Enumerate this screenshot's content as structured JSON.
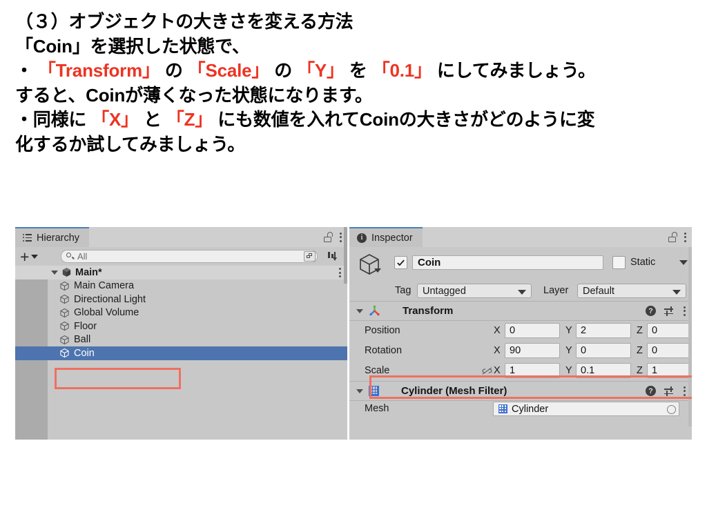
{
  "slide": {
    "lines": [
      [
        {
          "t": "（３）オブジェクトの大きさを変える方法",
          "c": "black"
        }
      ],
      [
        {
          "t": "「Coin」を選択した状態で、",
          "c": "black"
        }
      ],
      [
        {
          "t": "・",
          "c": "black"
        },
        {
          "t": "「Transform」",
          "c": "red"
        },
        {
          "t": "の",
          "c": "black"
        },
        {
          "t": "「Scale」",
          "c": "red"
        },
        {
          "t": "の",
          "c": "black"
        },
        {
          "t": "「Y」",
          "c": "red"
        },
        {
          "t": "を",
          "c": "black"
        },
        {
          "t": "「0.1」",
          "c": "red"
        },
        {
          "t": "にしてみましょう。",
          "c": "black"
        }
      ],
      [
        {
          "t": "すると、Coinが薄くなった状態になります。",
          "c": "black"
        }
      ],
      [
        {
          "t": "・同様に",
          "c": "black"
        },
        {
          "t": "「X」",
          "c": "red"
        },
        {
          "t": "と",
          "c": "black"
        },
        {
          "t": "「Z」",
          "c": "red"
        },
        {
          "t": "にも数値を入れてCoinの大きさがどのように変",
          "c": "black"
        }
      ],
      [
        {
          "t": "化するか試してみましょう。",
          "c": "black"
        }
      ]
    ],
    "accent_red": "#ee3322"
  },
  "hierarchy": {
    "tab_label": "Hierarchy",
    "tab_icon": "list-icon",
    "lock_icon": "lock-open-icon",
    "menu_icon": "kebab-menu-icon",
    "add_button_label": "+",
    "search": {
      "value": "All",
      "placeholder": "All",
      "icon": "search-icon",
      "popout_icon": "popout-icon"
    },
    "sort_icon": "sort-icon",
    "root": {
      "label": "Main*",
      "expanded": true,
      "icon": "unity-scene-icon"
    },
    "items": [
      {
        "label": "Main Camera",
        "icon": "gameobject-cube-icon",
        "selected": false
      },
      {
        "label": "Directional Light",
        "icon": "gameobject-cube-icon",
        "selected": false
      },
      {
        "label": "Global Volume",
        "icon": "gameobject-cube-icon",
        "selected": false
      },
      {
        "label": "Floor",
        "icon": "gameobject-cube-icon",
        "selected": false
      },
      {
        "label": "Ball",
        "icon": "gameobject-cube-icon",
        "selected": false
      },
      {
        "label": "Coin",
        "icon": "gameobject-cube-icon",
        "selected": true
      }
    ],
    "selection_color": "#4d74ae",
    "highlight_color": "#ef7060"
  },
  "inspector": {
    "tab_label": "Inspector",
    "tab_icon": "info-icon",
    "lock_icon": "lock-open-icon",
    "menu_icon": "kebab-menu-icon",
    "object": {
      "icon": "gameobject-cube-icon",
      "enabled": true,
      "name": "Coin",
      "static_label": "Static",
      "static_checked": false
    },
    "tag": {
      "label": "Tag",
      "value": "Untagged"
    },
    "layer": {
      "label": "Layer",
      "value": "Default"
    },
    "transform": {
      "title": "Transform",
      "icon": "transform-gizmo-icon",
      "expanded": true,
      "help_icon": "help-icon",
      "preset_icon": "settings-sliders-icon",
      "menu_icon": "kebab-menu-icon",
      "rows": [
        {
          "label": "Position",
          "x": "0",
          "y": "2",
          "z": "0",
          "highlighted": false,
          "link_icon": null
        },
        {
          "label": "Rotation",
          "x": "90",
          "y": "0",
          "z": "0",
          "highlighted": false,
          "link_icon": null
        },
        {
          "label": "Scale",
          "x": "1",
          "y": "0.1",
          "z": "1",
          "highlighted": true,
          "link_icon": "link-broken-icon"
        }
      ],
      "axis_labels": [
        "X",
        "Y",
        "Z"
      ]
    },
    "mesh_filter": {
      "title": "Cylinder (Mesh Filter)",
      "icon": "mesh-grid-icon",
      "expanded": true,
      "help_icon": "help-icon",
      "preset_icon": "settings-sliders-icon",
      "menu_icon": "kebab-menu-icon",
      "mesh_label": "Mesh",
      "mesh_value": "Cylinder",
      "mesh_icon": "mesh-grid-icon"
    }
  }
}
